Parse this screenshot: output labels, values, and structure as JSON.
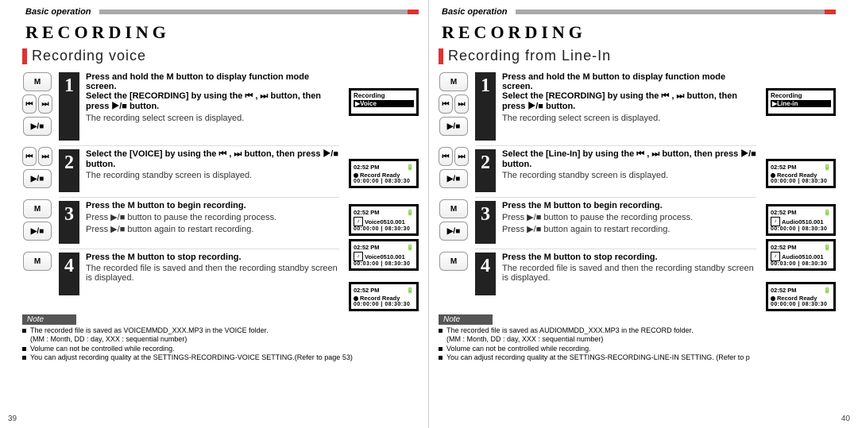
{
  "glyphs": {
    "M": "M",
    "rew": "⏮",
    "fwd": "⏭",
    "playstop": "▶/■"
  },
  "left": {
    "header": "Basic operation",
    "title": "RECORDING",
    "subtitle": "Recording voice",
    "pagenum": "39",
    "steps": [
      {
        "num": "1",
        "bold": "Press and hold the M button to display function mode screen.\nSelect the [RECORDING] by using the ⏮ , ⏭ button, then press ▶/■ button.",
        "result": "The recording select screen is displayed.",
        "lcd": {
          "mode": "menu",
          "header": "Recording",
          "item": "▶Voice"
        }
      },
      {
        "num": "2",
        "bold": "Select the [VOICE] by using the ⏮ , ⏭ button, then press ▶/■ button.",
        "result": "The recording standby screen is displayed.",
        "lcd": {
          "mode": "rec",
          "clock": "02:52 PM",
          "status": "Record Ready",
          "time": "00:00:00 | 08:30:30"
        }
      },
      {
        "num": "3",
        "bold": "Press the M button to begin recording.",
        "lines": [
          "Press ▶/■ button to pause the recording process.",
          "Press ▶/■ button again to restart recording."
        ],
        "lcd": {
          "mode": "double",
          "clock": "02:52 PM",
          "file1": "Voice0510.001",
          "time1": "00:00:00 | 08:30:30",
          "file2": "Voice0510.001",
          "time2": "00:03:00 | 08:30:30"
        }
      },
      {
        "num": "4",
        "bold": "Press the M button to stop recording.",
        "result": "The recorded file is saved and then the recording standby screen is displayed.",
        "lcd": {
          "mode": "rec",
          "clock": "02:52 PM",
          "status": "Record Ready",
          "time": "00:00:00 | 08:30:30"
        }
      }
    ],
    "notes": [
      "The recorded file is saved as VOICEMMDD_XXX.MP3 in the VOICE folder.\n(MM : Month, DD : day, XXX : sequential number)",
      "Volume can not be controlled while recording.",
      "You can adjust recording quality at the SETTINGS-RECORDING-VOICE SETTING.(Refer to page 53)"
    ]
  },
  "right": {
    "header": "Basic operation",
    "title": "RECORDING",
    "subtitle": "Recording from Line-In",
    "pagenum": "40",
    "steps": [
      {
        "num": "1",
        "bold": "Press and hold the M button to display function mode screen.\nSelect the [RECORDING] by using the ⏮ , ⏭ button, then press ▶/■ button.",
        "result": "The recording select screen is displayed.",
        "lcd": {
          "mode": "menu",
          "header": "Recording",
          "item": "▶Line-in"
        }
      },
      {
        "num": "2",
        "bold": "Select the [Line-In] by using the ⏮ , ⏭ button, then press ▶/■ button.",
        "result": "The recording standby screen is displayed.",
        "lcd": {
          "mode": "rec",
          "clock": "02:52 PM",
          "status": "Record Ready",
          "time": "00:00:00 | 08:30:30"
        }
      },
      {
        "num": "3",
        "bold": "Press the M button to begin recording.",
        "lines": [
          "Press ▶/■ button to pause the recording process.",
          "Press ▶/■ button again to restart recording."
        ],
        "lcd": {
          "mode": "double",
          "clock": "02:52 PM",
          "file1": "Audio0510.001",
          "time1": "00:00:00 | 08:30:30",
          "file2": "Audio0510.001",
          "time2": "00:03:00 | 08:30:30"
        }
      },
      {
        "num": "4",
        "bold": "Press the M button to stop recording.",
        "result": "The recorded file is saved and then the recording standby screen is displayed.",
        "lcd": {
          "mode": "rec",
          "clock": "02:52 PM",
          "status": "Record Ready",
          "time": "00:00:00 | 08:30:30"
        }
      }
    ],
    "notes": [
      "The recorded file is saved as AUDIOMMDD_XXX.MP3 in the RECORD folder.\n(MM : Month, DD : day, XXX : sequential number)",
      "Volume can not be controlled while recording.",
      "You can adjust recording quality at the SETTINGS-RECORDING-LINE-IN SETTING. (Refer to p"
    ]
  }
}
